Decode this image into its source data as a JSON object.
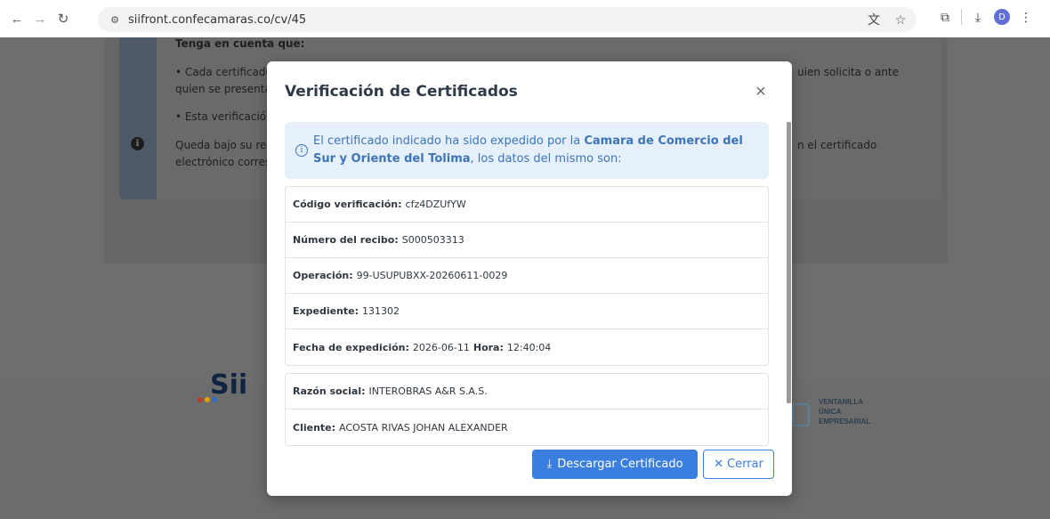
{
  "browser": {
    "url": "siifront.confecamaras.co/cv/45",
    "profile_initial": "D"
  },
  "background": {
    "notice_title": "Tenga en cuenta que:",
    "notice_line1": "• Cada certificado",
    "notice_line1_right": "uien solicita o ante",
    "notice_line2": "quien se presenta",
    "notice_line3": "• Esta verificación",
    "notice_line4": "Queda bajo su res",
    "notice_line4_right": "n el certificado",
    "notice_line5": "electrónico corres",
    "brand_logo": "Sii",
    "vue_logo": [
      "VENTANILLA",
      "ÚNICA",
      "EMPRESARIAL"
    ]
  },
  "modal": {
    "title": "Verificación de Certificados",
    "alert": {
      "prefix": "El certificado indicado ha sido expedido por la ",
      "entity": "Camara de Comercio del Sur y Oriente del Tolima",
      "suffix": ", los datos del mismo son:"
    },
    "group1": [
      {
        "label": "Código verificación:",
        "value": "cfz4DZUfYW"
      },
      {
        "label": "Número del recibo:",
        "value": "S000503313"
      },
      {
        "label": "Operación:",
        "value": "99-USUPUBXX-20260611-0029"
      },
      {
        "label": "Expediente:",
        "value": "131302"
      }
    ],
    "fecha": {
      "label": "Fecha de expedición:",
      "value": "2026-06-11",
      "hora_label": "Hora:",
      "hora_value": "12:40:04"
    },
    "group2": [
      {
        "label": "Razón social:",
        "value": "INTEROBRAS A&R S.A.S."
      },
      {
        "label": "Cliente:",
        "value": "ACOSTA RIVAS JOHAN ALEXANDER"
      }
    ],
    "download_label": "Descargar Certificado",
    "close_label": "Cerrar"
  }
}
